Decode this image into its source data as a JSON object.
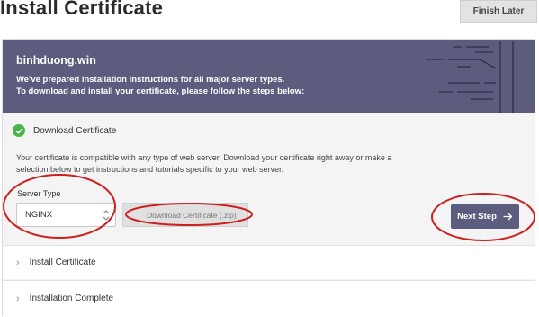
{
  "header": {
    "title": "Install Certificate",
    "finish_label": "Finish Later"
  },
  "banner": {
    "domain": "binhduong.win",
    "line1": "We've prepared installation instructions for all major server types.",
    "line2": "To download and install your certificate, please follow the steps below:",
    "background_color": "#5c5d7e"
  },
  "step_download": {
    "title": "Download Certificate",
    "status_icon": "check-circle-icon",
    "status_color": "#4bb34b",
    "description": "Your certificate is compatible with any type of web server. Download your certificate right away or make a selection below to get instructions and tutorials specific to your web server.",
    "server_type_label": "Server Type",
    "server_type_value": "NGINX",
    "download_button": "Download Certificate (.zip)",
    "next_button": "Next Step"
  },
  "steps": [
    {
      "label": "Install Certificate"
    },
    {
      "label": "Installation Complete"
    }
  ],
  "annotation_color": "#cc1f1f"
}
